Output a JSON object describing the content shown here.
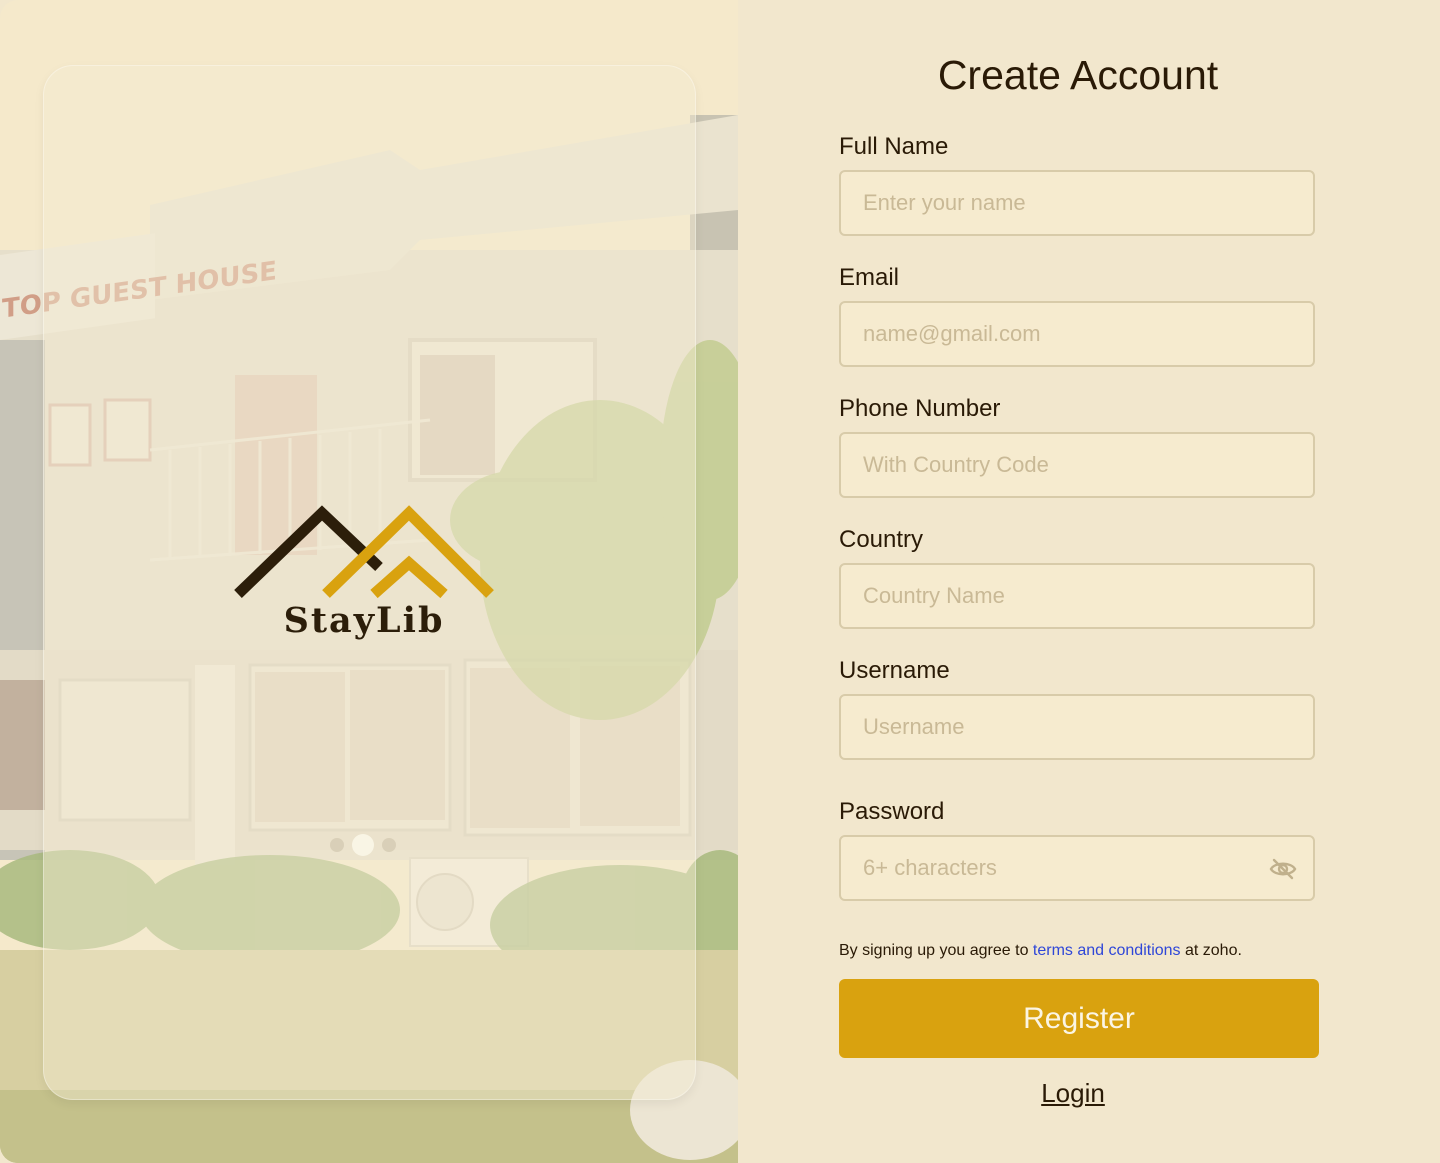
{
  "brand": {
    "name": "StayLib",
    "dark_color": "#2c1e0a",
    "gold_color": "#d9a20f"
  },
  "photo": {
    "sign_text": "TOP GUEST HOUSE"
  },
  "carousel": {
    "slide_count": 3,
    "active_index": 1
  },
  "form": {
    "title": "Create Account",
    "fields": [
      {
        "label": "Full Name",
        "placeholder": "Enter your name"
      },
      {
        "label": "Email",
        "placeholder": "name@gmail.com"
      },
      {
        "label": "Phone Number",
        "placeholder": "With Country Code"
      },
      {
        "label": "Country",
        "placeholder": "Country Name"
      },
      {
        "label": "Username",
        "placeholder": "Username"
      },
      {
        "label": "Password",
        "placeholder": "6+ characters",
        "icon": "eye-off-icon"
      }
    ],
    "terms": {
      "prefix": "By signing up you agree to ",
      "link": "terms and conditions",
      "suffix": " at zoho."
    },
    "register_label": "Register",
    "login_label": "Login"
  },
  "colors": {
    "background": "#f2e7cd",
    "input_bg": "#f6ebcf",
    "input_border": "#d8cba9",
    "link": "#2f47d8"
  }
}
